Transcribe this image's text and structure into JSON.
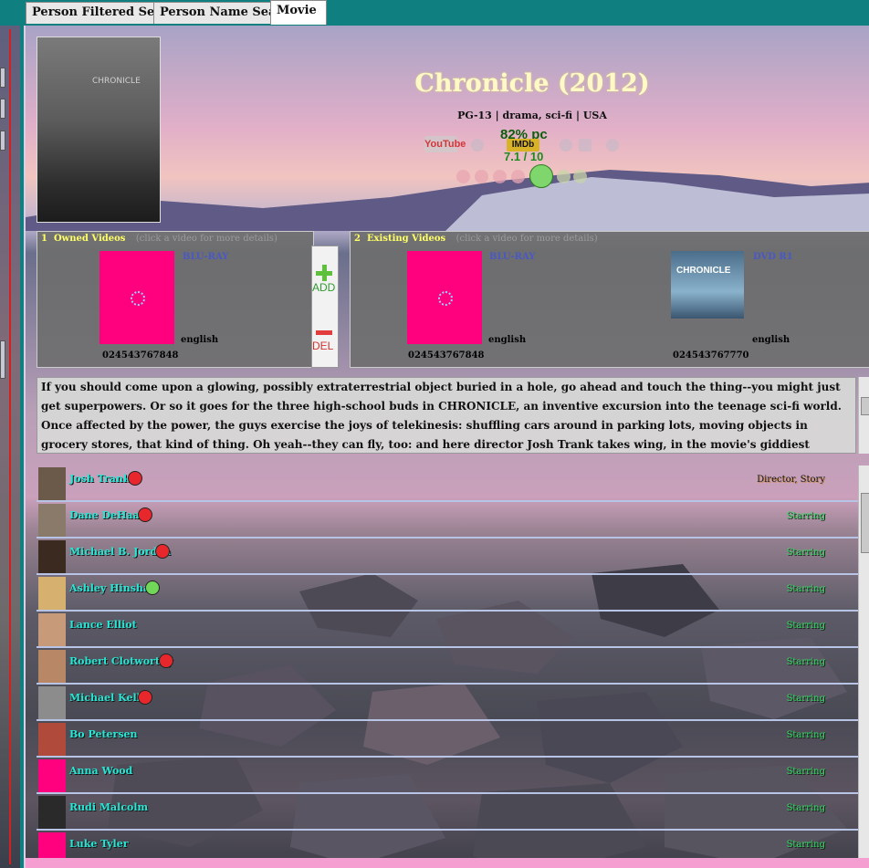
{
  "tabs": [
    {
      "label": "Person Filtered Search",
      "active": false
    },
    {
      "label": "Person Name Search",
      "active": false
    },
    {
      "label": "Movie",
      "active": true
    }
  ],
  "movie": {
    "title": "Chronicle (2012)",
    "subline": "PG-13 | drama, sci-fi | USA",
    "rating_pct": "82% pc",
    "imdb_label": "IMDb",
    "imdb_score": "7.1 / 10",
    "youtube_label": "YouTube",
    "poster_title": "CHRONICLE",
    "smileys": [
      "very-sad",
      "sad",
      "unhappy",
      "neutral",
      "happy",
      "very-happy",
      "ecstatic"
    ],
    "selected_smiley": "happy"
  },
  "owned": {
    "count": "1",
    "title": "Owned Videos",
    "hint": "(click a video for more details)",
    "videos": [
      {
        "type": "BLU-RAY",
        "lang": "english",
        "code": "024543767848"
      }
    ],
    "add_label": "ADD",
    "del_label": "DEL"
  },
  "existing": {
    "count": "2",
    "title": "Existing Videos",
    "hint": "(click a video for more details)",
    "videos": [
      {
        "type": "BLU-RAY",
        "lang": "english",
        "code": "024543767848"
      },
      {
        "type": "DVD R1",
        "lang": "english",
        "code": "024543767770",
        "cover_title": "CHRONICLE"
      }
    ]
  },
  "description": "If you should come upon a glowing, possibly extraterrestrial object buried in a hole, go ahead and touch the thing--you might just get superpowers. Or so it goes for the three high-school buds in CHRONICLE, an inventive excursion into the teenage sci-fi world. Once affected by the power, the guys exercise the joys of telekinesis: shuffling cars around in parking lots, moving objects in grocery stores, that kind of thing. Oh yeah--they can fly, too: and here director Josh Trank takes wing, in the movie's giddiest sequence, as the trio zips around the clouds in a glorious wish-fulfillment. It goes without saying that there will be a shadow",
  "cast": [
    {
      "name": "Josh Trank",
      "role": "Director,  Story",
      "emoji": "red",
      "avatar": "#6b5a4a"
    },
    {
      "name": "Dane DeHaan",
      "role": "Starring",
      "emoji": "red",
      "avatar": "#8a7a6a"
    },
    {
      "name": "Michael B. Jordan",
      "role": "Starring",
      "emoji": "red",
      "avatar": "#3b2a20"
    },
    {
      "name": "Ashley Hinshaw",
      "role": "Starring",
      "emoji": "green",
      "avatar": "#d6b06e"
    },
    {
      "name": "Lance Elliot",
      "role": "Starring",
      "emoji": "",
      "avatar": "#c79b7a"
    },
    {
      "name": "Robert Clotworthy",
      "role": "Starring",
      "emoji": "red",
      "avatar": "#b88866"
    },
    {
      "name": "Michael Kelly",
      "role": "Starring",
      "emoji": "red",
      "avatar": "#8c8c8c"
    },
    {
      "name": "Bo Petersen",
      "role": "Starring",
      "emoji": "",
      "avatar": "#b04a3a"
    },
    {
      "name": "Anna Wood",
      "role": "Starring",
      "emoji": "",
      "avatar": "#ff007f"
    },
    {
      "name": "Rudi Malcolm",
      "role": "Starring",
      "emoji": "",
      "avatar": "#2a2a2a"
    },
    {
      "name": "Luke Tyler",
      "role": "Starring",
      "emoji": "",
      "avatar": "#ff007f"
    }
  ]
}
